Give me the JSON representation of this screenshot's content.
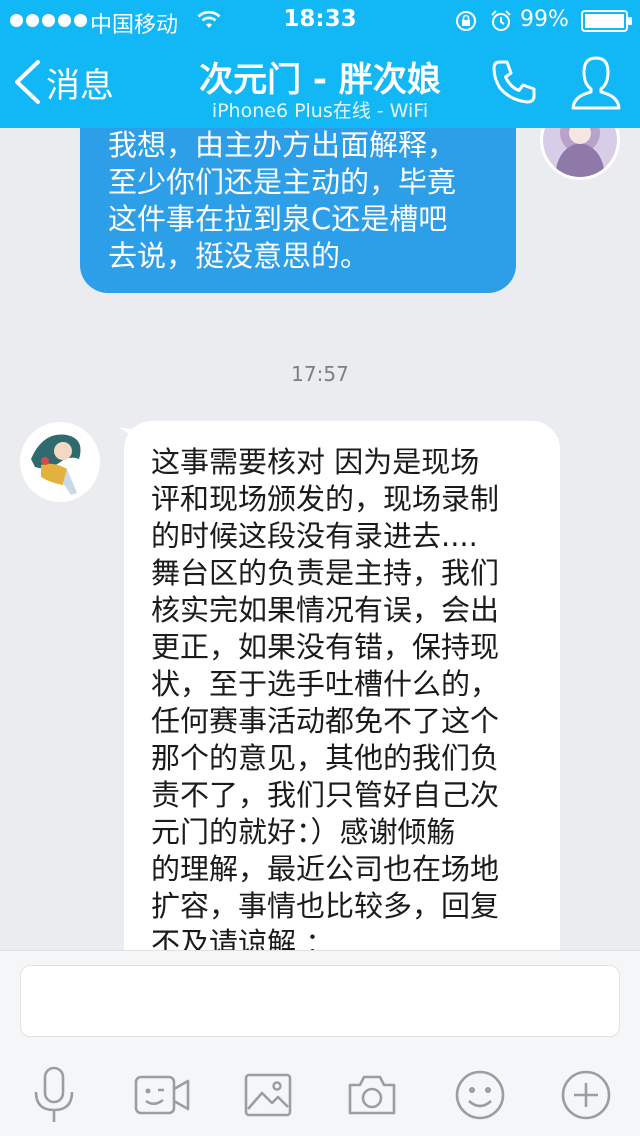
{
  "status_bar": {
    "carrier": "中国移动",
    "time": "18:33",
    "battery": "99%"
  },
  "header": {
    "back_label": "消息",
    "title": "次元门 - 胖次娘",
    "subtitle": "iPhone6 Plus在线 - WiFi"
  },
  "messages": {
    "outgoing": {
      "text": "我想，由主办方出面解释，\n至少你们还是主动的，毕竟\n这件事在拉到泉C还是槽吧\n去说，挺没意思的。"
    },
    "timestamp": "17:57",
    "incoming": {
      "text": "这事需要核对 因为是现场\n评和现场颁发的，现场录制\n的时候这段没有录进去....\n舞台区的负责是主持，我们\n核实完如果情况有误，会出\n更正，如果没有错，保持现\n状，至于选手吐槽什么的，\n任何赛事活动都免不了这个\n那个的意见，其他的我们负\n责不了，我们只管好自己次\n元门的就好：）感谢倾觞\n的理解，最近公司也在场地\n扩容，事情也比较多，回复\n不及请谅解 ："
    }
  },
  "toolbar_icons": [
    "microphone-icon",
    "video-call-icon",
    "image-icon",
    "camera-icon",
    "emoji-icon",
    "plus-icon"
  ],
  "colors": {
    "header": "#12b7f5",
    "outgoing_bubble": "#2d9ee8",
    "incoming_bubble": "#ffffff",
    "background": "#ebecef"
  }
}
